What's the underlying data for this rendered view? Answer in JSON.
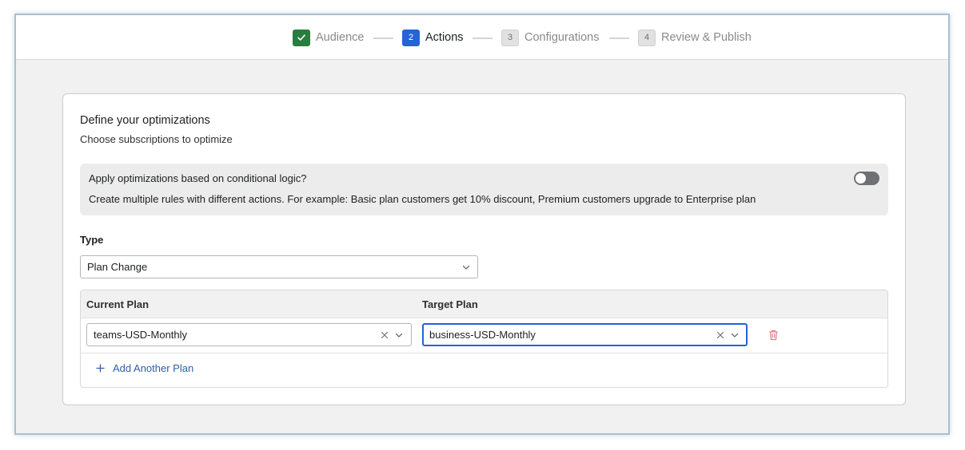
{
  "stepper": {
    "steps": [
      {
        "number": "",
        "label": "Audience",
        "state": "completed",
        "icon": "check-icon"
      },
      {
        "number": "2",
        "label": "Actions",
        "state": "active"
      },
      {
        "number": "3",
        "label": "Configurations",
        "state": "pending"
      },
      {
        "number": "4",
        "label": "Review & Publish",
        "state": "pending"
      }
    ]
  },
  "card": {
    "title": "Define your optimizations",
    "subtitle": "Choose subscriptions to optimize",
    "conditional": {
      "title": "Apply optimizations based on conditional logic?",
      "description": "Create multiple rules with different actions. For example: Basic plan customers get 10% discount, Premium customers upgrade to Enterprise plan",
      "toggle_on": false
    },
    "type": {
      "label": "Type",
      "value": "Plan Change",
      "icon": "chevron-down-icon"
    },
    "plans": {
      "headers": {
        "current": "Current Plan",
        "target": "Target Plan"
      },
      "rows": [
        {
          "current": "teams-USD-Monthly",
          "target": "business-USD-Monthly"
        }
      ],
      "add_label": "Add Another Plan",
      "delete_icon": "trash-icon"
    }
  },
  "colors": {
    "accent": "#2563d6",
    "success": "#2a7d3e",
    "link": "#2c5fa8",
    "danger": "#e0707e"
  }
}
